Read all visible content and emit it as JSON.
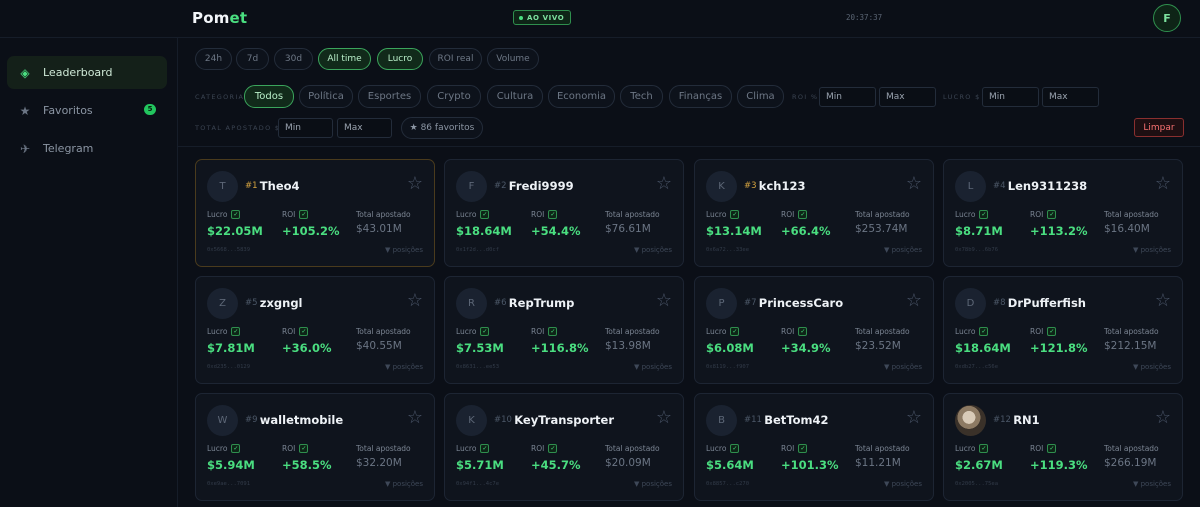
{
  "header": {
    "logo_main": "Pom",
    "logo_accent": "et",
    "live_label": "AO VIVO",
    "time": "20:37:37",
    "user_initial": "F"
  },
  "sidebar": {
    "items": [
      {
        "label": "Leaderboard",
        "icon": "diamond-icon"
      },
      {
        "label": "Favoritos",
        "icon": "star-icon",
        "badge": "5"
      },
      {
        "label": "Telegram",
        "icon": "paper-plane-icon"
      }
    ]
  },
  "period_filters": [
    "24h",
    "7d",
    "30d",
    "All time"
  ],
  "metric_filters": [
    "Lucro",
    "ROI real",
    "Volume"
  ],
  "categories_label": "CATEGORIA",
  "categories": [
    "Todos",
    "Política",
    "Esportes",
    "Crypto",
    "Cultura",
    "Economia",
    "Tech",
    "Finanças",
    "Clima"
  ],
  "roi_filter": {
    "label": "ROI %",
    "min_placeholder": "Min",
    "max_placeholder": "Max"
  },
  "lucro_filter": {
    "label": "LUCRO $",
    "min_placeholder": "Min",
    "max_placeholder": "Max"
  },
  "total_filter": {
    "label": "TOTAL APOSTADO $",
    "min_placeholder": "Min",
    "max_placeholder": "Max"
  },
  "favorites_chip": "★ 86 favoritos",
  "clear_label": "Limpar",
  "card_labels": {
    "profit": "Lucro",
    "roi": "ROI",
    "total": "Total apostado",
    "positions": "▼ posições",
    "check": "✓"
  },
  "traders": [
    {
      "rank": "#1",
      "initial": "T",
      "name": "Theo4",
      "profit": "$22.05M",
      "roi": "+105.2%",
      "total": "$43.01M",
      "address": "0x5668...5839"
    },
    {
      "rank": "#2",
      "initial": "F",
      "name": "Fredi9999",
      "profit": "$18.64M",
      "roi": "+54.4%",
      "total": "$76.61M",
      "address": "0x1f2d...d0cf"
    },
    {
      "rank": "#3",
      "initial": "K",
      "name": "kch123",
      "profit": "$13.14M",
      "roi": "+66.4%",
      "total": "$253.74M",
      "address": "0x6a72...33ee"
    },
    {
      "rank": "#4",
      "initial": "L",
      "name": "Len9311238",
      "profit": "$8.71M",
      "roi": "+113.2%",
      "total": "$16.40M",
      "address": "0x78b9...6b76"
    },
    {
      "rank": "#5",
      "initial": "Z",
      "name": "zxgngl",
      "profit": "$7.81M",
      "roi": "+36.0%",
      "total": "$40.55M",
      "address": "0xd235...0129"
    },
    {
      "rank": "#6",
      "initial": "R",
      "name": "RepTrump",
      "profit": "$7.53M",
      "roi": "+116.8%",
      "total": "$13.98M",
      "address": "0x8631...ee53"
    },
    {
      "rank": "#7",
      "initial": "P",
      "name": "PrincessCaro",
      "profit": "$6.08M",
      "roi": "+34.9%",
      "total": "$23.52M",
      "address": "0x8119...f907"
    },
    {
      "rank": "#8",
      "initial": "D",
      "name": "DrPufferfish",
      "profit": "$18.64M",
      "roi": "+121.8%",
      "total": "$212.15M",
      "address": "0xdb27...c56e"
    },
    {
      "rank": "#9",
      "initial": "W",
      "name": "walletmobile",
      "profit": "$5.94M",
      "roi": "+58.5%",
      "total": "$32.20M",
      "address": "0xe9ae...7091"
    },
    {
      "rank": "#10",
      "initial": "K",
      "name": "KeyTransporter",
      "profit": "$5.71M",
      "roi": "+45.7%",
      "total": "$20.09M",
      "address": "0x94f1...4c7e"
    },
    {
      "rank": "#11",
      "initial": "B",
      "name": "BetTom42",
      "profit": "$5.64M",
      "roi": "+101.3%",
      "total": "$11.21M",
      "address": "0x8857...c270"
    },
    {
      "rank": "#12",
      "initial": "",
      "name": "RN1",
      "profit": "$2.67M",
      "roi": "+119.3%",
      "total": "$266.19M",
      "address": "0x2005...75ea"
    }
  ]
}
